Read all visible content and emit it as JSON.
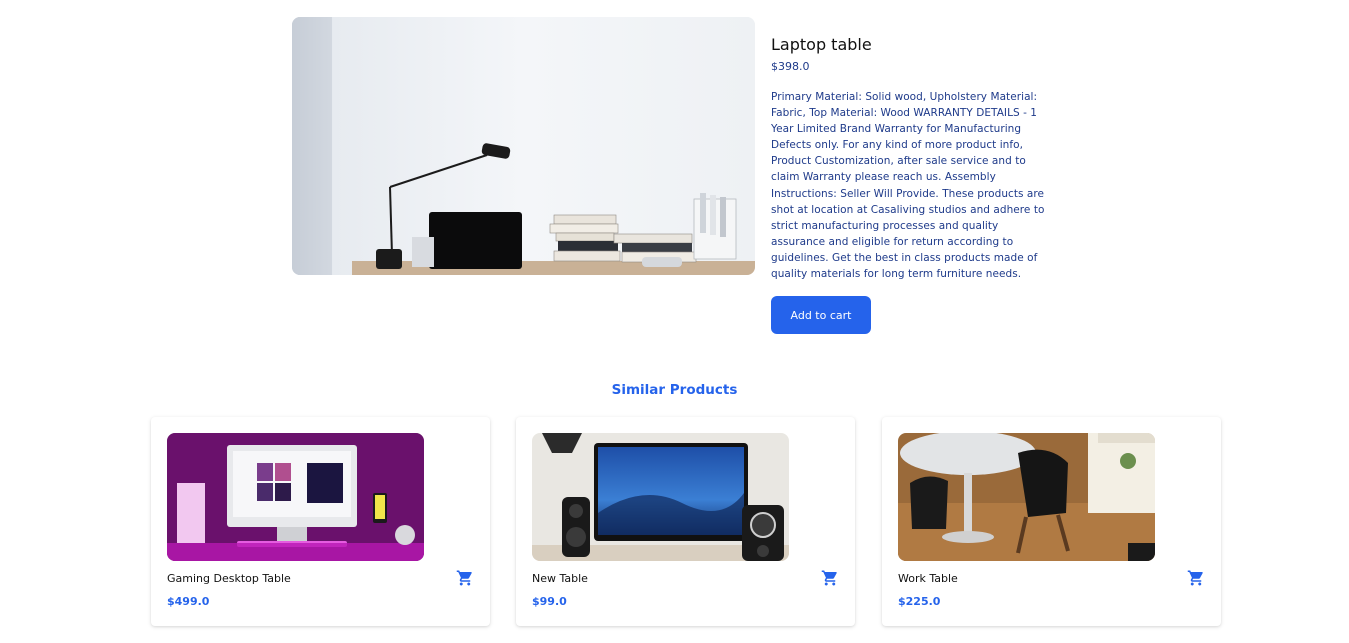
{
  "product": {
    "image_alt": "Desk with laptop, lamp and books",
    "title": "Laptop table",
    "price": "$398.0",
    "description": "Primary Material: Solid wood, Upholstery Material: Fabric, Top Material: Wood WARRANTY DETAILS - 1 Year Limited Brand Warranty for Manufacturing Defects only. For any kind of more product info, Product Customization, after sale service and to claim Warranty please reach us. Assembly Instructions: Seller Will Provide. These products are shot at location at Casaliving studios and adhere to strict manufacturing processes and quality assurance and eligible for return according to guidelines. Get the best in class products made of quality materials for long term furniture needs.",
    "add_to_cart_label": "Add to cart"
  },
  "similar": {
    "title": "Similar Products",
    "items": [
      {
        "name": "Gaming Desktop Table",
        "price": "$499.0",
        "icon": "cart-icon"
      },
      {
        "name": "New Table",
        "price": "$99.0",
        "icon": "cart-icon"
      },
      {
        "name": "Work Table",
        "price": "$225.0",
        "icon": "cart-icon"
      }
    ]
  },
  "colors": {
    "accent": "#2563eb",
    "description_text": "#1e3a8a"
  }
}
